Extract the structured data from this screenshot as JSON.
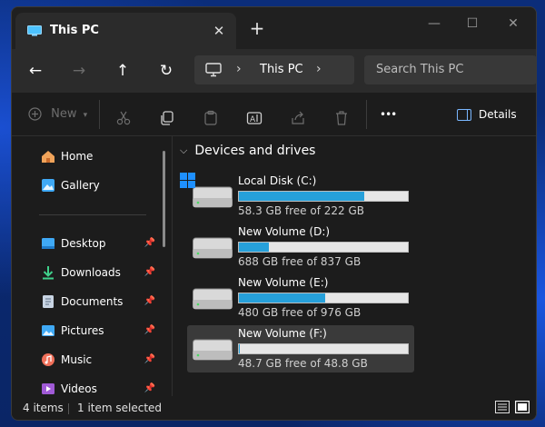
{
  "window": {
    "tab_title": "This PC",
    "tab_close": "✕",
    "new_tab": "+",
    "controls": {
      "minimize": "—",
      "maximize": "☐",
      "close": "✕"
    }
  },
  "nav": {
    "back": "←",
    "forward": "→",
    "up": "↑",
    "refresh": "↻",
    "chevron": "›",
    "breadcrumb": "This PC",
    "search_placeholder": "Search This PC"
  },
  "toolbar": {
    "new_label": "New",
    "more": "•••",
    "details_label": "Details"
  },
  "sidebar": {
    "items": [
      {
        "label": "Home",
        "icon": "home-icon",
        "pinned": false
      },
      {
        "label": "Gallery",
        "icon": "gallery-icon",
        "pinned": false
      },
      {
        "label": "Desktop",
        "icon": "desktop-icon",
        "pinned": true
      },
      {
        "label": "Downloads",
        "icon": "download-icon",
        "pinned": true
      },
      {
        "label": "Documents",
        "icon": "documents-icon",
        "pinned": true
      },
      {
        "label": "Pictures",
        "icon": "pictures-icon",
        "pinned": true
      },
      {
        "label": "Music",
        "icon": "music-icon",
        "pinned": true
      },
      {
        "label": "Videos",
        "icon": "videos-icon",
        "pinned": true
      }
    ],
    "pin_glyph": "📌"
  },
  "content": {
    "group_title": "Devices and drives",
    "drives": [
      {
        "name": "Local Disk (C:)",
        "free": "58.3 GB free of 222 GB",
        "used_fraction": 0.74,
        "system": true
      },
      {
        "name": "New Volume (D:)",
        "free": "688 GB free of 837 GB",
        "used_fraction": 0.18,
        "system": false
      },
      {
        "name": "New Volume (E:)",
        "free": "480 GB free of 976 GB",
        "used_fraction": 0.51,
        "system": false
      },
      {
        "name": "New Volume (F:)",
        "free": "48.7 GB free of 48.8 GB",
        "used_fraction": 0.002,
        "system": false,
        "selected": true
      }
    ]
  },
  "status": {
    "items_count": "4 items",
    "selection": "1 item selected"
  },
  "colors": {
    "accent": "#26a0da",
    "background": "#1c1c1c",
    "selected": "#3a3a3a"
  }
}
